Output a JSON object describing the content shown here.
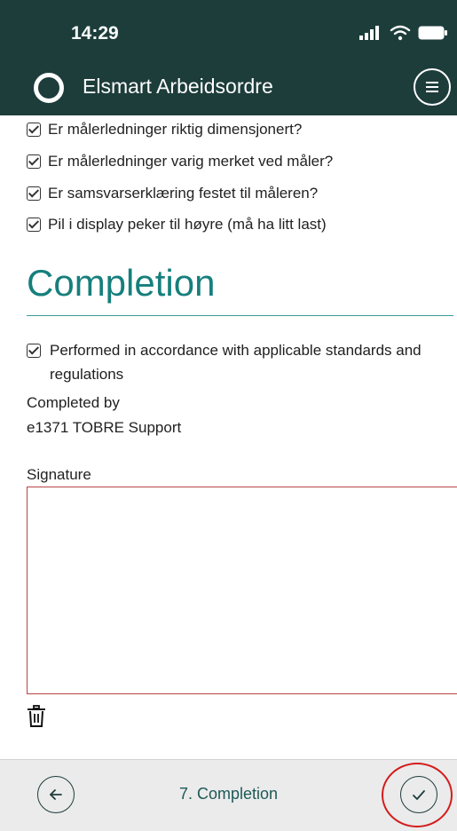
{
  "status": {
    "time": "14:29"
  },
  "app": {
    "title": "Elsmart Arbeidsordre"
  },
  "checklist": [
    {
      "label": "Er målerledninger riktig dimensjonert?"
    },
    {
      "label": "Er målerledninger varig merket ved måler?"
    },
    {
      "label": "Er samsvarserklæring festet til måleren?"
    },
    {
      "label": "Pil i display peker til høyre (må ha litt last)"
    }
  ],
  "completion": {
    "title": "Completion",
    "compliance_label": "Performed in accordance with applicable standards and regulations",
    "completed_by_label": "Completed by",
    "completed_by_value": "e1371 TOBRE Support",
    "signature_label": "Signature"
  },
  "footer": {
    "step_label": "7. Completion"
  },
  "colors": {
    "header_bg": "#1d3d3b",
    "accent": "#167f7c",
    "signature_border": "#b84444",
    "annotation": "#d41c1c"
  },
  "icons": {
    "logo": "circle-logo-icon",
    "menu": "hamburger-menu-icon",
    "checkbox": "checkbox-checked-icon",
    "trash": "trash-icon",
    "back": "arrow-left-icon",
    "confirm": "checkmark-icon"
  }
}
